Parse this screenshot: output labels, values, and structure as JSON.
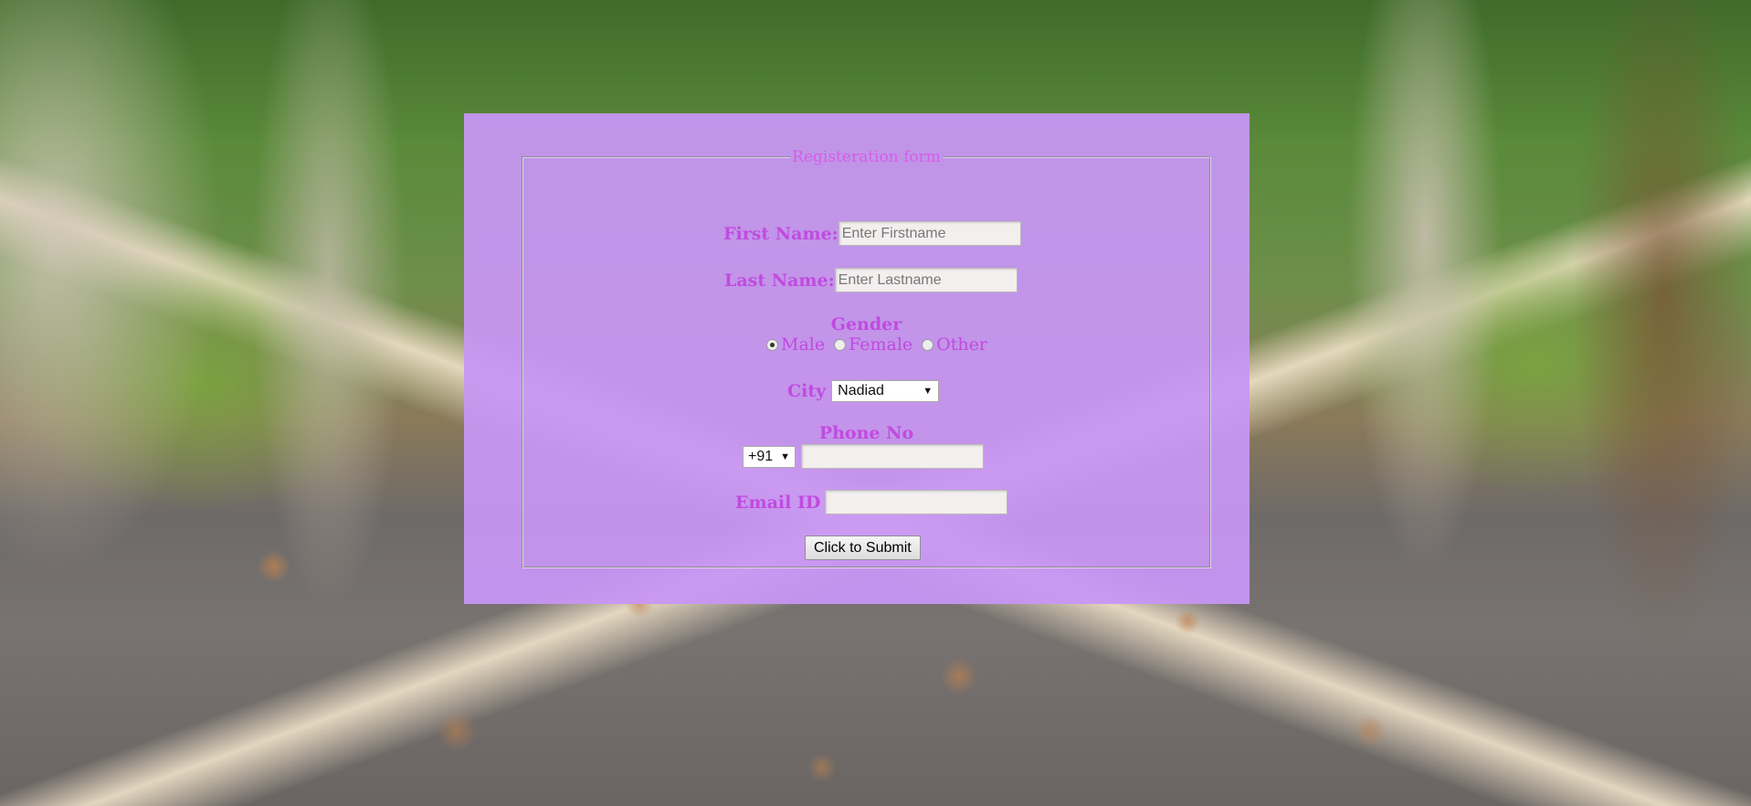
{
  "form": {
    "legend": "Registeration form",
    "first_name": {
      "label": "First Name:",
      "placeholder": "Enter Firstname",
      "value": ""
    },
    "last_name": {
      "label": "Last Name:",
      "placeholder": "Enter Lastname",
      "value": ""
    },
    "gender": {
      "label": "Gender",
      "options": [
        {
          "label": "Male",
          "checked": true
        },
        {
          "label": "Female",
          "checked": false
        },
        {
          "label": "Other",
          "checked": false
        }
      ]
    },
    "city": {
      "label": "City",
      "selected": "Nadiad"
    },
    "phone": {
      "label": "Phone No",
      "country_code": "+91",
      "value": ""
    },
    "email": {
      "label": "Email ID",
      "value": ""
    },
    "submit_label": "Click to Submit"
  },
  "icons": {
    "dropdown": "chevron-down-icon",
    "radio": "radio-button-icon"
  },
  "colors": {
    "panel_background": "#c896f5",
    "label_color": "#c14ae0",
    "legend_color": "#d65ce8"
  }
}
